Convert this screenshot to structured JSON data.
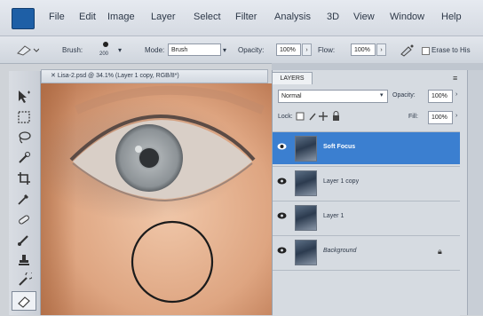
{
  "app": {
    "menu": [
      "File",
      "Edit",
      "Image",
      "Layer",
      "Select",
      "Filter",
      "Analysis",
      "3D",
      "View",
      "Window",
      "Help"
    ]
  },
  "options_bar": {
    "brush_label": "Brush:",
    "brush_size": "200",
    "mode_label": "Mode:",
    "mode_value": "Brush",
    "opacity_label": "Opacity:",
    "opacity_value": "100%",
    "flow_label": "Flow:",
    "flow_value": "100%",
    "erase_label": "Erase to His"
  },
  "document": {
    "tab_title": "Lisa-2.psd @ 34.1% (Layer 1 copy, RGB/8*)"
  },
  "layers_panel": {
    "tab_label": "LAYERS",
    "blend_mode": "Normal",
    "opacity_label": "Opacity:",
    "opacity_value": "100%",
    "lock_label": "Lock:",
    "fill_label": "Fill:",
    "fill_value": "100%",
    "layers": [
      {
        "name": "Soft Focus",
        "selected": true
      },
      {
        "name": "Layer 1 copy",
        "selected": false
      },
      {
        "name": "Layer 1",
        "selected": false
      },
      {
        "name": "Background",
        "selected": false,
        "locked": true
      }
    ]
  },
  "icons": {
    "layer_locked": "lock-icon",
    "visibility": "eye-icon"
  },
  "colors": {
    "accent": "#3b7fd0",
    "skin": "#e0b08f"
  }
}
